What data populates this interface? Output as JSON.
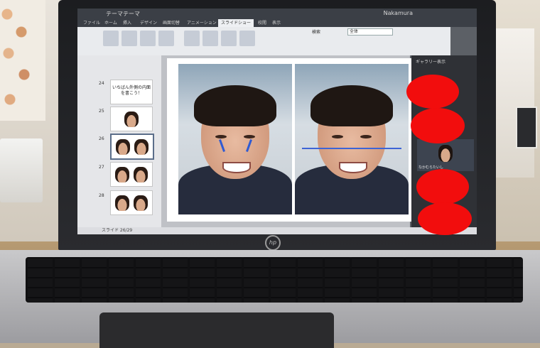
{
  "screen": {
    "window_title": "テーマテーマ",
    "window_right": "Nakamura",
    "tabs": [
      "ファイル",
      "ホーム",
      "挿入",
      "デザイン",
      "画面切替",
      "アニメーション",
      "スライドショー",
      "校閲",
      "表示"
    ],
    "active_tab": 6,
    "find_label": "検索",
    "find_value": "全体",
    "slide_numbers": [
      "24",
      "25",
      "26",
      "27",
      "28"
    ],
    "slide_24_text": "いちばん外側の内面を書こう！",
    "selected_slide": "26",
    "status_text": "スライド 26/29",
    "right_pane_title": "ギャラリー表示",
    "camera_name": "なかむらたいし"
  },
  "colors": {
    "redaction": "#f20d0d",
    "marker_blue": "#3d64d6"
  },
  "brand": {
    "logo": "hp"
  }
}
